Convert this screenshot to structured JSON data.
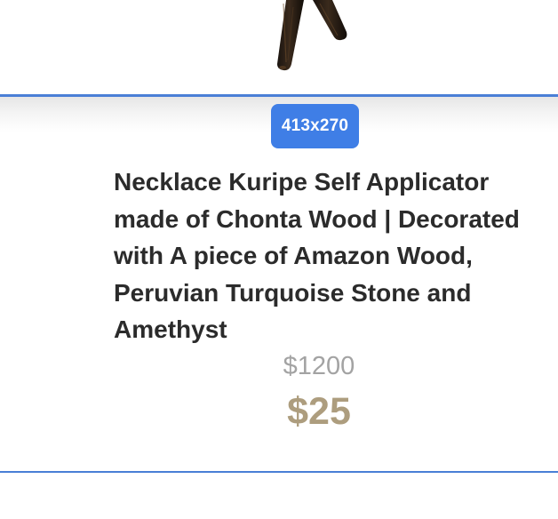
{
  "product": {
    "image_alt": "chonta wood necklace kuripe",
    "image_size_badge": "413x270",
    "title": "Necklace Kuripe Self Applicator made of Chonta Wood | Decorated with A piece of Amazon Wood, Peruvian Turquoise Stone and Amethyst",
    "original_price": "$1200",
    "sale_price": "$25"
  },
  "colors": {
    "accent_blue": "#4a7fd6",
    "badge_blue": "#3f7ee6",
    "title_text": "#2b2b2b",
    "old_price_gray": "#a3a3a3",
    "sale_price_gold": "#ad9d7e"
  }
}
